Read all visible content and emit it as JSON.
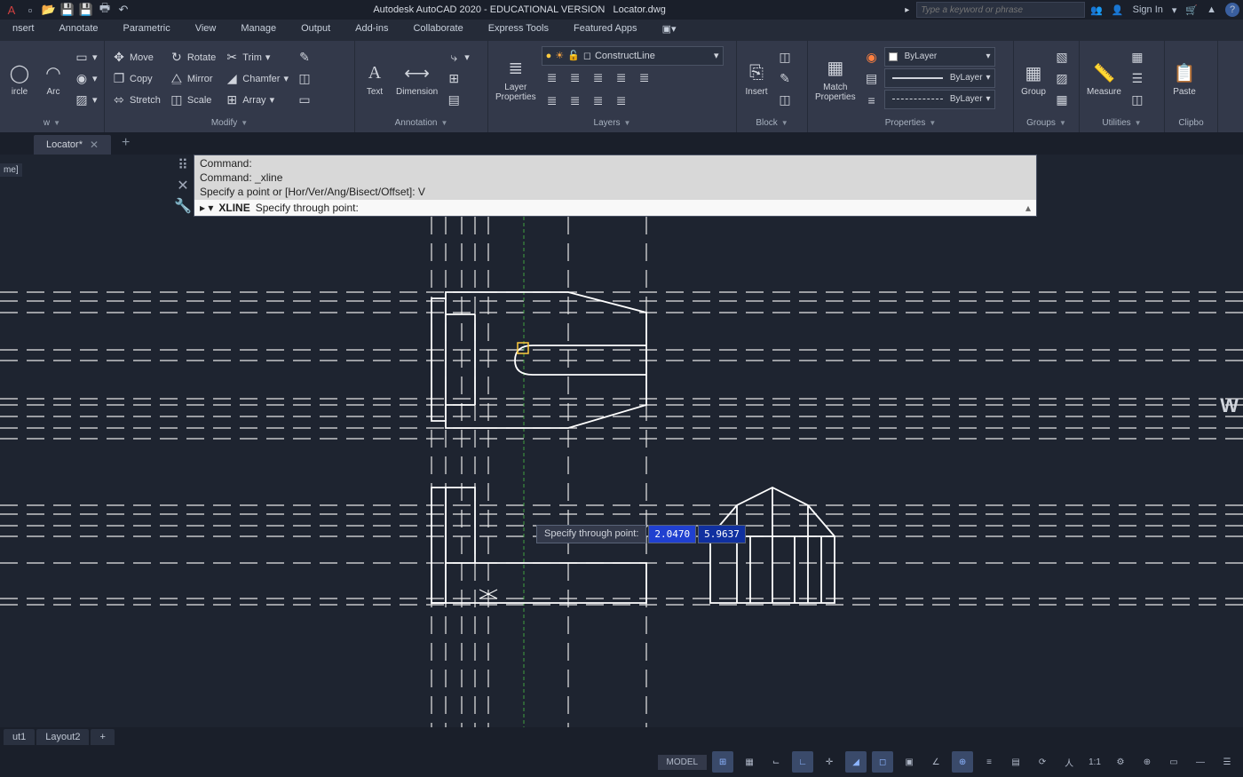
{
  "title": {
    "app": "Autodesk AutoCAD 2020 - EDUCATIONAL VERSION",
    "file": "Locator.dwg",
    "search_placeholder": "Type a keyword or phrase",
    "sign_in": "Sign In"
  },
  "menu": [
    "nsert",
    "Annotate",
    "Parametric",
    "View",
    "Manage",
    "Output",
    "Add-ins",
    "Collaborate",
    "Express Tools",
    "Featured Apps"
  ],
  "ribbon": {
    "draw": {
      "label": "w",
      "circle": "ircle",
      "arc": "Arc"
    },
    "modify": {
      "label": "Modify",
      "col1": [
        "Move",
        "Copy",
        "Stretch"
      ],
      "col2": [
        "Rotate",
        "Mirror",
        "Scale"
      ],
      "col3": [
        "Trim",
        "Chamfer",
        "Array"
      ]
    },
    "annotation": {
      "label": "Annotation",
      "text": "Text",
      "dimension": "Dimension"
    },
    "layers": {
      "label": "Layers",
      "properties": "Layer\nProperties",
      "current": "ConstructLine"
    },
    "block": {
      "label": "Block",
      "insert": "Insert"
    },
    "properties": {
      "label": "Properties",
      "match": "Match\nProperties",
      "layer": "ByLayer",
      "linetype": "ByLayer",
      "lineweight": "ByLayer"
    },
    "groups": {
      "label": "Groups",
      "group": "Group"
    },
    "utilities": {
      "label": "Utilities",
      "measure": "Measure"
    },
    "clipboard": {
      "label": "Clipbo",
      "paste": "Paste"
    }
  },
  "file_tab": {
    "name": "Locator*"
  },
  "side_panel": "me]",
  "command": {
    "history": [
      "Command:",
      "Command: _xline",
      "Specify a point or [Hor/Ver/Ang/Bisect/Offset]: V"
    ],
    "prompt_prefix": "XLINE",
    "prompt": "Specify through point:"
  },
  "dynamic_input": {
    "label": "Specify through point:",
    "value1": "2.0470",
    "value2": "5.9637"
  },
  "layout_tabs": [
    "ut1",
    "Layout2"
  ],
  "status": {
    "model": "MODEL",
    "scale": "1:1"
  },
  "wcs": "W"
}
